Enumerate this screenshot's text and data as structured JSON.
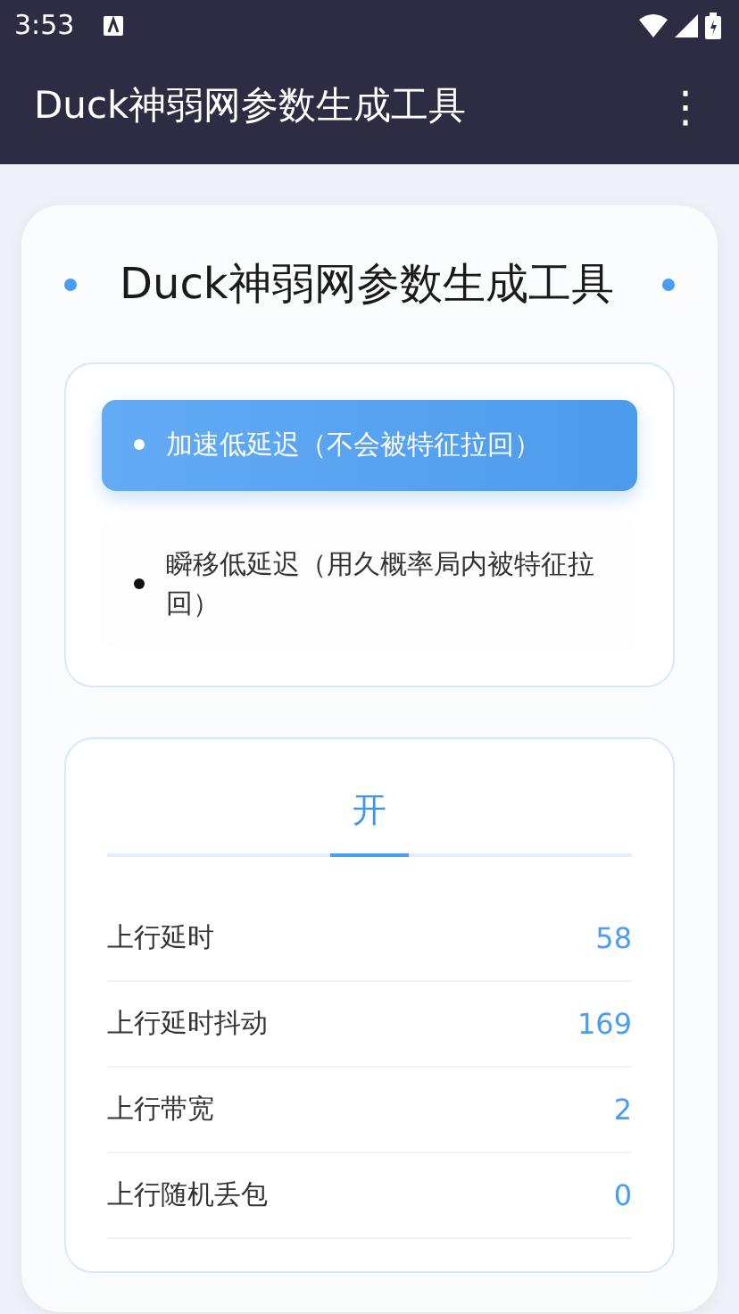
{
  "status_bar": {
    "time": "3:53"
  },
  "app_bar": {
    "title": "Duck神弱网参数生成工具",
    "menu": "⋮"
  },
  "heading": "Duck神弱网参数生成工具",
  "modes": [
    {
      "label": "加速低延迟（不会被特征拉回）",
      "selected": true
    },
    {
      "label": "瞬移低延迟（用久概率局内被特征拉回）",
      "selected": false
    }
  ],
  "tabs": [
    {
      "label": "开",
      "selected": true
    }
  ],
  "params": [
    {
      "label": "上行延时",
      "value": "58"
    },
    {
      "label": "上行延时抖动",
      "value": "169"
    },
    {
      "label": "上行带宽",
      "value": "2"
    },
    {
      "label": "上行随机丢包",
      "value": "0"
    }
  ]
}
